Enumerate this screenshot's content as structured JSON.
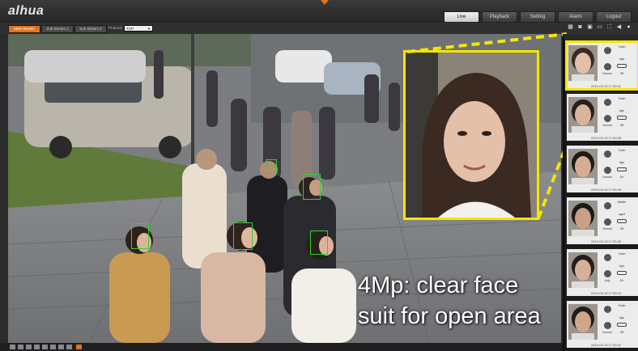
{
  "header": {
    "logo": "alhua",
    "nav_tabs": [
      {
        "label": "Live",
        "active": true
      },
      {
        "label": "Playback",
        "active": false
      },
      {
        "label": "Setting",
        "active": false
      },
      {
        "label": "Alarm",
        "active": false
      },
      {
        "label": "Logout",
        "active": false
      }
    ]
  },
  "toolbar": {
    "streams": [
      {
        "label": "Main Stream",
        "active": true
      },
      {
        "label": "Sub Stream 1",
        "active": false
      },
      {
        "label": "Sub Stream 2",
        "active": false
      }
    ],
    "protocol_label": "Protocol:",
    "protocol_value": "TCP",
    "panel_icons": [
      "grid-icon",
      "camera-icon",
      "record-icon",
      "video-icon",
      "fullscreen-icon",
      "volume-icon",
      "mic-icon"
    ]
  },
  "overlay": {
    "caption_line1": "4Mp: clear face",
    "caption_line2": "suit for open area"
  },
  "face_panel": {
    "cards": [
      {
        "time": "2019-03-19 17:30:31",
        "age_label": "Youth",
        "age_sub": "Age",
        "expr": "Normal",
        "glasses": "Off",
        "selected": true
      },
      {
        "time": "2019-03-19 17:30:28",
        "age_label": "Youth",
        "age_sub": "Age",
        "expr": "Normal",
        "glasses": "Off",
        "selected": false
      },
      {
        "time": "2019-03-19 17:30:26",
        "age_label": "Youth",
        "age_sub": "Age",
        "expr": "Normal",
        "glasses": "On",
        "selected": false
      },
      {
        "time": "2019-03-19 17:30:25",
        "age_label": "Middle",
        "age_sub": "aged",
        "expr": "Normal",
        "glasses": "Off",
        "selected": false
      },
      {
        "time": "2019-03-19 17:30:24",
        "age_label": "Youth",
        "age_sub": "Age",
        "expr": "Jolly",
        "glasses": "On",
        "selected": false
      },
      {
        "time": "2019-03-19 17:30:22",
        "age_label": "Youth",
        "age_sub": "Age",
        "expr": "Normal",
        "glasses": "Off",
        "selected": false
      }
    ]
  },
  "colors": {
    "accent": "#e0731f",
    "highlight": "#f3e600",
    "face_box": "#2fd12f"
  }
}
